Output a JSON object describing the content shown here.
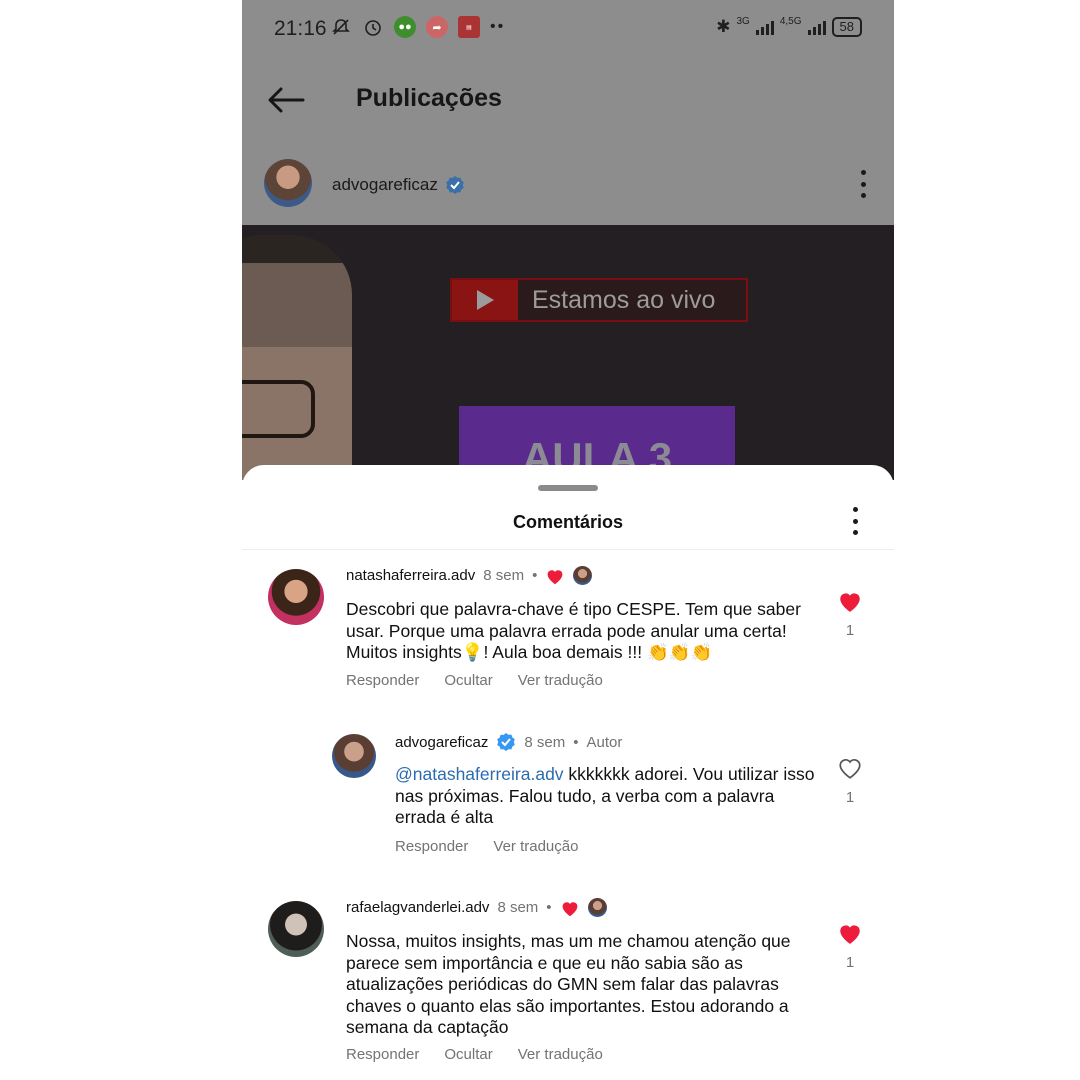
{
  "status_bar": {
    "time": "21:16",
    "network_1": "3G",
    "network_2": "4,5G",
    "battery": "58"
  },
  "header": {
    "title": "Publicações"
  },
  "post": {
    "username": "advogareficaz",
    "image_live_text": "Estamos ao vivo",
    "image_banner_text": "AULA 3"
  },
  "comments_sheet": {
    "title": "Comentários",
    "comments": [
      {
        "username": "natashaferreira.adv",
        "time": "8 sem",
        "text": "Descobri que palavra-chave é tipo CESPE. Tem que saber usar. Porque uma palavra errada pode anular uma certa! Muitos insights💡! Aula boa demais !!! 👏👏👏",
        "actions": [
          "Responder",
          "Ocultar",
          "Ver tradução"
        ],
        "likes": "1",
        "liked": true
      },
      {
        "username": "advogareficaz",
        "time": "8 sem",
        "author_label": "Autor",
        "mention": "@natashaferreira.adv",
        "text": " kkkkkkk adorei. Vou utilizar isso nas próximas. Falou tudo, a verba com a palavra errada é alta",
        "actions": [
          "Responder",
          "Ver tradução"
        ],
        "likes": "1",
        "liked": false
      },
      {
        "username": "rafaelagvanderlei.adv",
        "time": "8 sem",
        "text": "Nossa, muitos insights, mas um me chamou atenção que parece sem importância e que eu não sabia são as atualizações periódicas do GMN sem falar das palavras chaves o quanto elas são importantes. Estou adorando a semana da captação",
        "actions": [
          "Responder",
          "Ocultar",
          "Ver tradução"
        ],
        "likes": "1",
        "liked": true
      }
    ]
  },
  "colors": {
    "dim_overlay": "#8d8d8d",
    "like_red": "#ed1c3a",
    "mention_blue": "#2b6bb0",
    "verified_blue": "#3897f0"
  }
}
